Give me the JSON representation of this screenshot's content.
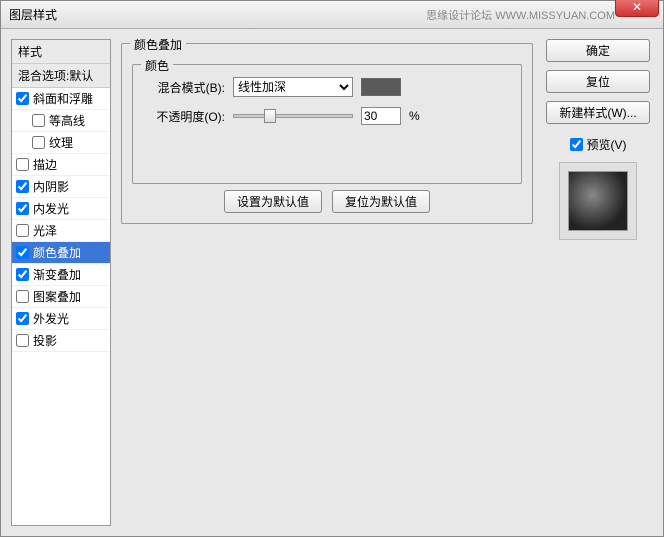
{
  "window": {
    "title": "图层样式",
    "watermark": "思缘设计论坛  WWW.MISSYUAN.COM"
  },
  "sidebar": {
    "header": "样式",
    "sub": "混合选项:默认",
    "items": [
      {
        "label": "斜面和浮雕",
        "checked": true,
        "indent": false
      },
      {
        "label": "等高线",
        "checked": false,
        "indent": true
      },
      {
        "label": "纹理",
        "checked": false,
        "indent": true
      },
      {
        "label": "描边",
        "checked": false,
        "indent": false
      },
      {
        "label": "内阴影",
        "checked": true,
        "indent": false
      },
      {
        "label": "内发光",
        "checked": true,
        "indent": false
      },
      {
        "label": "光泽",
        "checked": false,
        "indent": false
      },
      {
        "label": "颜色叠加",
        "checked": true,
        "indent": false,
        "selected": true
      },
      {
        "label": "渐变叠加",
        "checked": true,
        "indent": false
      },
      {
        "label": "图案叠加",
        "checked": false,
        "indent": false
      },
      {
        "label": "外发光",
        "checked": true,
        "indent": false
      },
      {
        "label": "投影",
        "checked": false,
        "indent": false
      }
    ]
  },
  "main": {
    "section_title": "颜色叠加",
    "group_title": "颜色",
    "blend_label": "混合模式(B):",
    "blend_value": "线性加深",
    "opacity_label": "不透明度(O):",
    "opacity_value": "30",
    "opacity_unit": "%",
    "defaults_btn": "设置为默认值",
    "reset_btn": "复位为默认值"
  },
  "right": {
    "ok": "确定",
    "cancel": "复位",
    "newstyle": "新建样式(W)...",
    "preview": "预览(V)"
  }
}
